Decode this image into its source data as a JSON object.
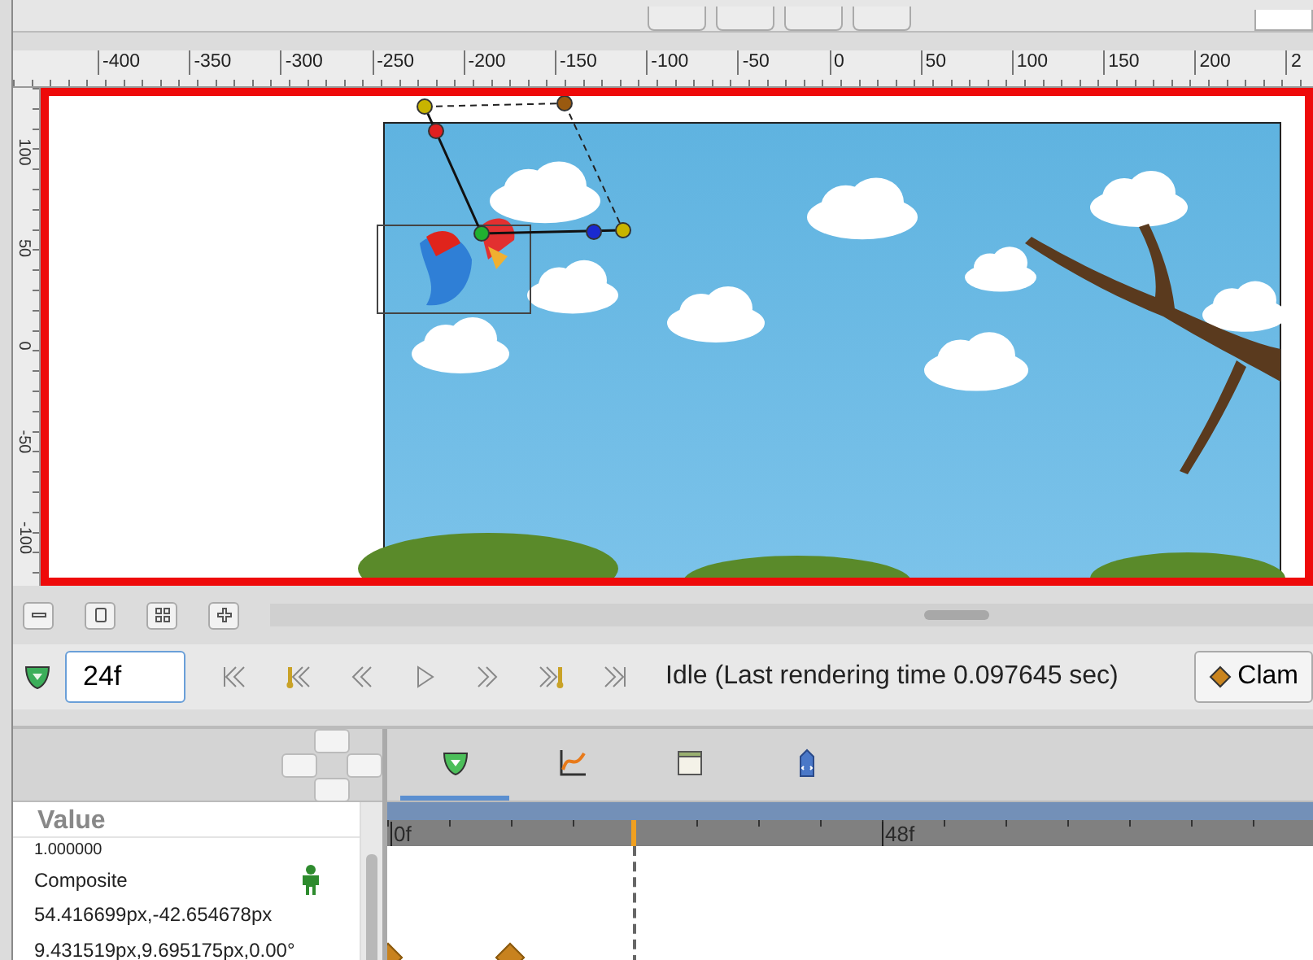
{
  "ruler_h": {
    "labels": [
      "-400",
      "-350",
      "-300",
      "-250",
      "-200",
      "-150",
      "-100",
      "-50",
      "0",
      "50",
      "100",
      "150",
      "200",
      "2"
    ]
  },
  "ruler_v": {
    "labels": [
      "100",
      "50",
      "0",
      "-50",
      "-100"
    ]
  },
  "timebar": {
    "frame_field": {
      "value": "24f"
    },
    "status": "Idle (Last rendering time 0.097645 sec)",
    "clamp_button": {
      "label": "Clam"
    }
  },
  "params": {
    "column": "Value",
    "rows": [
      {
        "value": "1.000000",
        "kind": "plain"
      },
      {
        "value": "Composite",
        "kind": "composite"
      },
      {
        "value": "54.416699px,-42.654678px",
        "kind": "plain"
      },
      {
        "value": "9.431519px,9.695175px,0.00°",
        "kind": "plain"
      }
    ]
  },
  "timetrack": {
    "tabs": [
      {
        "kind": "params",
        "selected": true
      },
      {
        "kind": "curves",
        "selected": false
      },
      {
        "kind": "library",
        "selected": false
      },
      {
        "kind": "navigator",
        "selected": false
      }
    ],
    "ruler": [
      "0f",
      "48f"
    ]
  }
}
